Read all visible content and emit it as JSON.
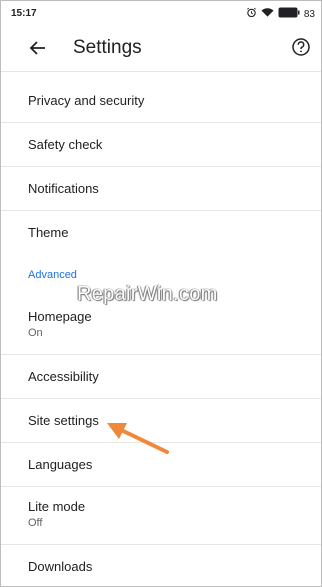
{
  "status_bar": {
    "time": "15:17",
    "battery_text": "83",
    "icons": [
      "alarm-icon",
      "wifi-icon",
      "battery-icon"
    ]
  },
  "toolbar": {
    "title": "Settings",
    "back_icon": "arrow-back-icon",
    "help_icon": "help-circle-icon"
  },
  "items": [
    {
      "label": "Privacy and security"
    },
    {
      "label": "Safety check"
    },
    {
      "label": "Notifications"
    },
    {
      "label": "Theme"
    },
    {
      "section": "Advanced"
    },
    {
      "label": "Homepage",
      "sub": "On"
    },
    {
      "label": "Accessibility"
    },
    {
      "label": "Site settings"
    },
    {
      "label": "Languages"
    },
    {
      "label": "Lite mode",
      "sub": "Off"
    },
    {
      "label": "Downloads"
    }
  ],
  "watermark": "RepairWin.com",
  "colors": {
    "accent": "#1a73e8",
    "arrow": "#f0883a",
    "divider": "#e6e6e6"
  }
}
